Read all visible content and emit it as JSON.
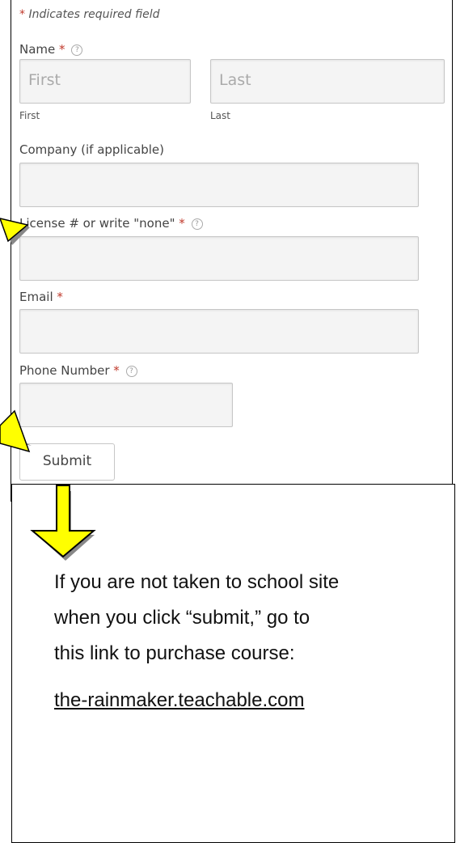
{
  "form": {
    "required_note": "Indicates required field",
    "required_star": "*",
    "name_label": "Name",
    "first_placeholder": "First",
    "last_placeholder": "Last",
    "first_sublabel": "First",
    "last_sublabel": "Last",
    "company_label": "Company (if applicable)",
    "license_label": "License # or write \"none\"",
    "email_label": "Email",
    "phone_label": "Phone Number",
    "help_glyph": "?",
    "submit_label": "Submit"
  },
  "info": {
    "line1": "If you are not taken to school site",
    "line2": "when you click “submit,” go to",
    "line3": "this link to purchase course:",
    "link_text": "the-rainmaker.teachable.com"
  },
  "colors": {
    "arrow_fill": "#ffff00",
    "arrow_stroke": "#000000",
    "required": "#c0392b"
  }
}
